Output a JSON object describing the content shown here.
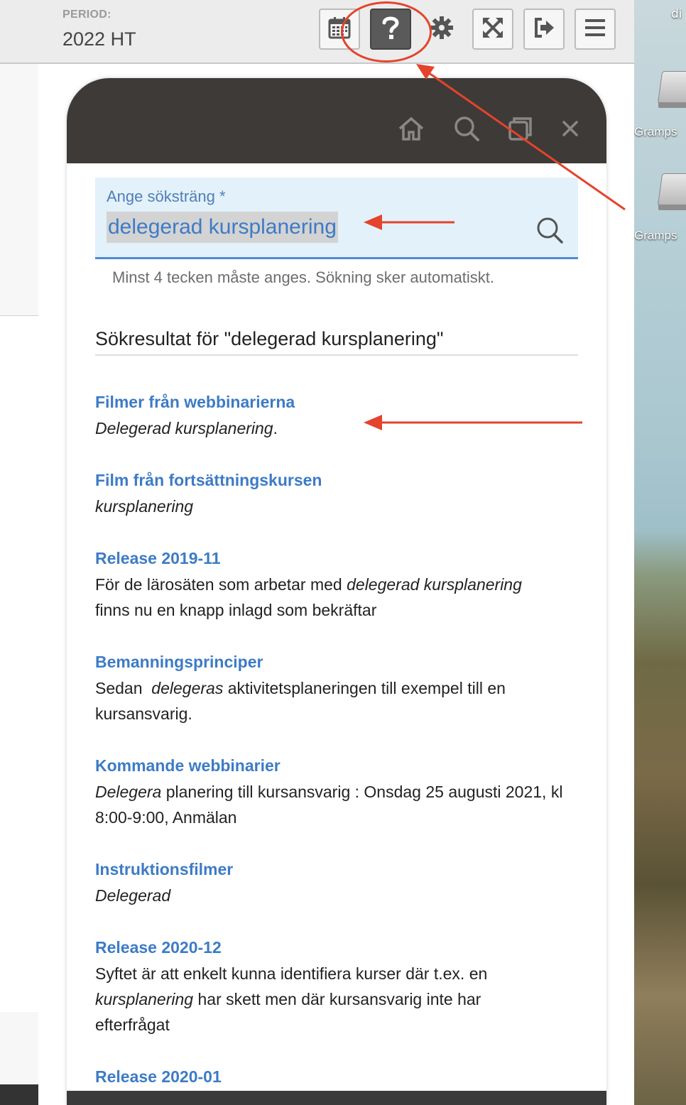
{
  "topbar": {
    "period_label": "PERIOD:",
    "period_value": "2022 HT",
    "buttons": [
      {
        "name": "calendar-icon"
      },
      {
        "name": "question-icon"
      },
      {
        "name": "gear-icon"
      },
      {
        "name": "expand-icon"
      },
      {
        "name": "logout-icon"
      },
      {
        "name": "hamburger-menu-icon"
      }
    ]
  },
  "desktop": {
    "top_label": "di",
    "disk1_label": "Gramps",
    "disk2_label": "Gramps"
  },
  "dialog": {
    "header_icons": [
      "home-icon",
      "search-icon",
      "windows-icon",
      "close-icon"
    ],
    "search": {
      "label": "Ange söksträng  *",
      "value": "delegerad kursplanering",
      "helper": "Minst 4 tecken måste anges. Sökning sker automatiskt."
    },
    "results_title": "Sökresultat för \"delegerad kursplanering\"",
    "results": [
      {
        "title": "Filmer från webbinarierna",
        "snippet_em": "Delegerad kursplanering",
        "snippet_after": "."
      },
      {
        "title": "Film från fortsättningskursen",
        "snippet_em": "kursplanering"
      },
      {
        "title": "Release 2019-11",
        "snippet_before": "För de lärosäten som arbetar med ",
        "snippet_em": "delegerad kursplanering",
        "snippet_line2": "finns nu en knapp inlagd som bekräftar"
      },
      {
        "title": "Bemanningsprinciper",
        "snippet_before": "Sedan  ",
        "snippet_em": "delegeras",
        "snippet_after": " aktivitetsplaneringen till exempel till en",
        "snippet_line2": "kursansvarig."
      },
      {
        "title": "Kommande webbinarier",
        "snippet_em": "Delegera",
        "snippet_after": " planering till kursansvarig : Onsdag 25 augusti 2021, kl",
        "snippet_line2": "8:00-9:00, Anmälan"
      },
      {
        "title": "Instruktionsfilmer",
        "snippet_em": "Delegerad"
      },
      {
        "title": "Release 2020-12",
        "snippet_before": "Syftet är att enkelt kunna identifiera kurser där t.ex. en",
        "snippet_em": "kursplanering",
        "snippet_after": " har skett men där kursansvarig inte har",
        "snippet_line3": "efterfrågat"
      },
      {
        "title": "Release 2020-01"
      }
    ]
  },
  "colors": {
    "annotation": "#e5432b",
    "link": "#3d7bc6",
    "header": "#3e3a37"
  }
}
